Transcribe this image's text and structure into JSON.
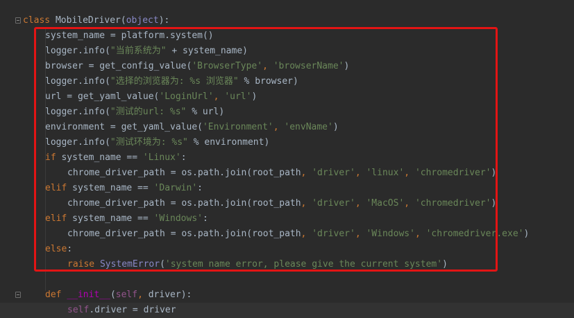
{
  "editor": {
    "lines": [
      {
        "indent": 0,
        "tokens": [
          [
            "k",
            "class "
          ],
          [
            "n",
            "MobileDriver("
          ],
          [
            "b",
            "object"
          ],
          [
            "n",
            "):"
          ]
        ]
      },
      {
        "indent": 1,
        "tokens": [
          [
            "n",
            "system_name = platform.system()"
          ]
        ]
      },
      {
        "indent": 1,
        "tokens": [
          [
            "n",
            "logger.info("
          ],
          [
            "s",
            "\"当前系统为\""
          ],
          [
            "n",
            " + system_name)"
          ]
        ]
      },
      {
        "indent": 1,
        "tokens": [
          [
            "n",
            "browser = get_config_value("
          ],
          [
            "s",
            "'BrowserType'"
          ],
          [
            "k",
            ", "
          ],
          [
            "s",
            "'browserName'"
          ],
          [
            "n",
            ")"
          ]
        ]
      },
      {
        "indent": 1,
        "tokens": [
          [
            "n",
            "logger.info("
          ],
          [
            "s",
            "\"选择的浏览器为: %s 浏览器\""
          ],
          [
            "n",
            " % browser)"
          ]
        ]
      },
      {
        "indent": 1,
        "tokens": [
          [
            "n",
            "url = get_yaml_value("
          ],
          [
            "s",
            "'LoginUrl'"
          ],
          [
            "k",
            ", "
          ],
          [
            "s",
            "'url'"
          ],
          [
            "n",
            ")"
          ]
        ]
      },
      {
        "indent": 1,
        "tokens": [
          [
            "n",
            "logger.info("
          ],
          [
            "s",
            "\"测试的url: %s\""
          ],
          [
            "n",
            " % url)"
          ]
        ]
      },
      {
        "indent": 1,
        "tokens": [
          [
            "n",
            "environment = get_yaml_value("
          ],
          [
            "s",
            "'Environment'"
          ],
          [
            "k",
            ", "
          ],
          [
            "s",
            "'envName'"
          ],
          [
            "n",
            ")"
          ]
        ]
      },
      {
        "indent": 1,
        "tokens": [
          [
            "n",
            "logger.info("
          ],
          [
            "s",
            "\"测试环境为: %s\""
          ],
          [
            "n",
            " % environment)"
          ]
        ]
      },
      {
        "indent": 1,
        "tokens": [
          [
            "k",
            "if "
          ],
          [
            "n",
            "system_name == "
          ],
          [
            "s",
            "'Linux'"
          ],
          [
            "n",
            ":"
          ]
        ]
      },
      {
        "indent": 2,
        "tokens": [
          [
            "n",
            "chrome_driver_path = os.path.join(root_path"
          ],
          [
            "k",
            ", "
          ],
          [
            "s",
            "'driver'"
          ],
          [
            "k",
            ", "
          ],
          [
            "s",
            "'linux'"
          ],
          [
            "k",
            ", "
          ],
          [
            "s",
            "'chromedriver'"
          ],
          [
            "n",
            ")"
          ]
        ]
      },
      {
        "indent": 1,
        "tokens": [
          [
            "k",
            "elif "
          ],
          [
            "n",
            "system_name == "
          ],
          [
            "s",
            "'Darwin'"
          ],
          [
            "n",
            ":"
          ]
        ]
      },
      {
        "indent": 2,
        "tokens": [
          [
            "n",
            "chrome_driver_path = os.path.join(root_path"
          ],
          [
            "k",
            ", "
          ],
          [
            "s",
            "'driver'"
          ],
          [
            "k",
            ", "
          ],
          [
            "s",
            "'MacOS'"
          ],
          [
            "k",
            ", "
          ],
          [
            "s",
            "'chromedriver'"
          ],
          [
            "n",
            ")"
          ]
        ]
      },
      {
        "indent": 1,
        "tokens": [
          [
            "k",
            "elif "
          ],
          [
            "n",
            "system_name == "
          ],
          [
            "s",
            "'Windows'"
          ],
          [
            "n",
            ":"
          ]
        ]
      },
      {
        "indent": 2,
        "tokens": [
          [
            "n",
            "chrome_driver_path = os.path.join(root_path"
          ],
          [
            "k",
            ", "
          ],
          [
            "s",
            "'driver'"
          ],
          [
            "k",
            ", "
          ],
          [
            "s",
            "'Windows'"
          ],
          [
            "k",
            ", "
          ],
          [
            "s",
            "'chromedriver.exe'"
          ],
          [
            "n",
            ")"
          ]
        ]
      },
      {
        "indent": 1,
        "tokens": [
          [
            "k",
            "else"
          ],
          [
            "n",
            ":"
          ]
        ]
      },
      {
        "indent": 2,
        "tokens": [
          [
            "k",
            "raise "
          ],
          [
            "b",
            "SystemError"
          ],
          [
            "n",
            "("
          ],
          [
            "s",
            "'system name error, please give the current system'"
          ],
          [
            "n",
            ")"
          ]
        ]
      },
      {
        "indent": 0,
        "tokens": []
      },
      {
        "indent": 1,
        "tokens": [
          [
            "k",
            "def "
          ],
          [
            "dn",
            "__init__"
          ],
          [
            "n",
            "("
          ],
          [
            "self",
            "self"
          ],
          [
            "k",
            ", "
          ],
          [
            "n",
            "driver):"
          ]
        ]
      },
      {
        "indent": 2,
        "tokens": [
          [
            "self",
            "self"
          ],
          [
            "n",
            ".driver = driver"
          ]
        ]
      }
    ]
  },
  "gutter": {
    "fold_icon": "fold-marker-icon",
    "intention_icon": "lightbulb-icon"
  },
  "annotation": {
    "highlight_color": "#e31414"
  }
}
